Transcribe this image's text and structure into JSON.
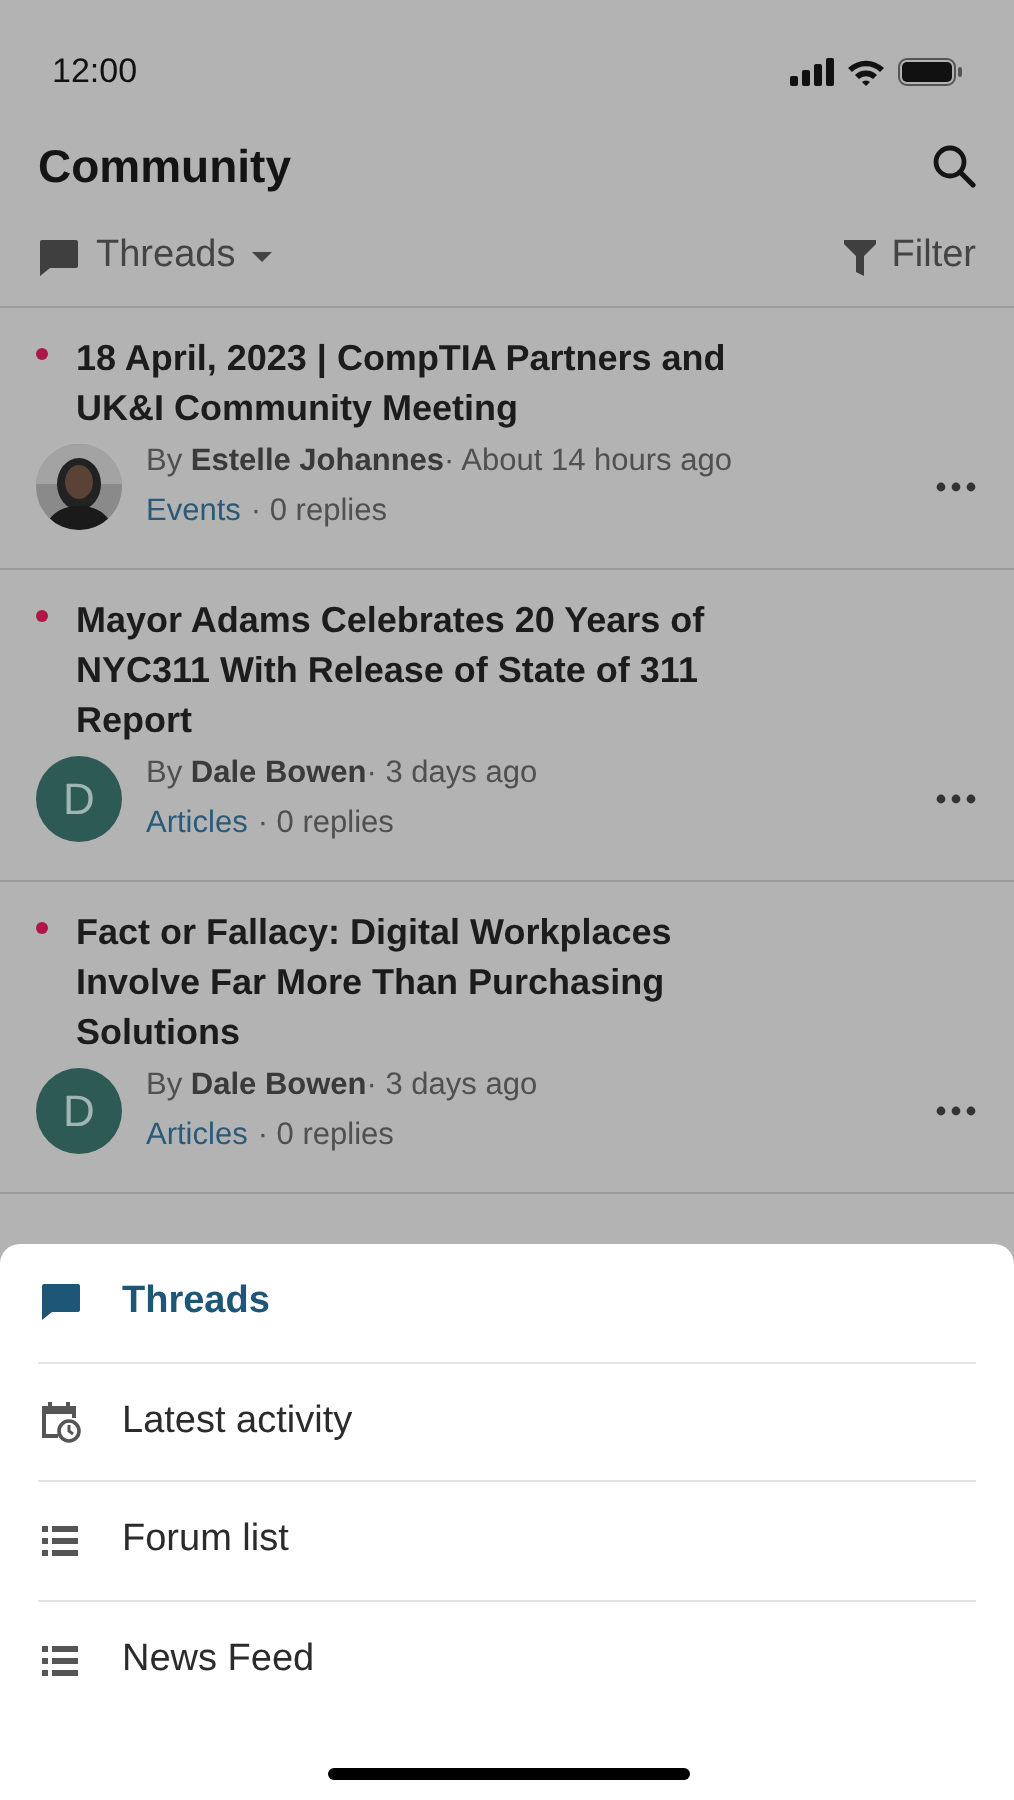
{
  "status_bar": {
    "time": "12:00"
  },
  "header": {
    "title": "Community"
  },
  "toolbar": {
    "view": "Threads",
    "filter": "Filter"
  },
  "posts": [
    {
      "unread": true,
      "title": "18 April, 2023 | CompTIA Partners and UK&I Community Meeting",
      "byline": "By **Estelle Johannes**· About 14 hours ago",
      "category": "Events",
      "replies": "· 0 replies"
    },
    {
      "unread": true,
      "title": "Mayor Adams Celebrates 20 Years of NYC311 With Release of State of 311 Report",
      "avatar": {
        "kind": "initial",
        "initial": "D"
      },
      "byline": "By **Dale Bowen**· 3 days ago",
      "category": "Articles",
      "replies": "· 0 replies"
    },
    {
      "unread": true,
      "title": "Fact or Fallacy: Digital Workplaces Involve Far More Than Purchasing Solutions",
      "avatar": {
        "kind": "initial",
        "initial": "D"
      },
      "byline": "By **Dale Bowen**· 3 days ago",
      "category": "Articles",
      "replies": "· 0 replies"
    }
  ],
  "sheet": {
    "items": [
      {
        "kind": "chat",
        "label": "Threads",
        "selected": true
      },
      {
        "kind": "calendar",
        "label": "Latest activity",
        "selected": false
      },
      {
        "kind": "list",
        "label": "Forum list",
        "selected": false
      },
      {
        "kind": "list",
        "label": "News Feed",
        "selected": false
      }
    ]
  }
}
